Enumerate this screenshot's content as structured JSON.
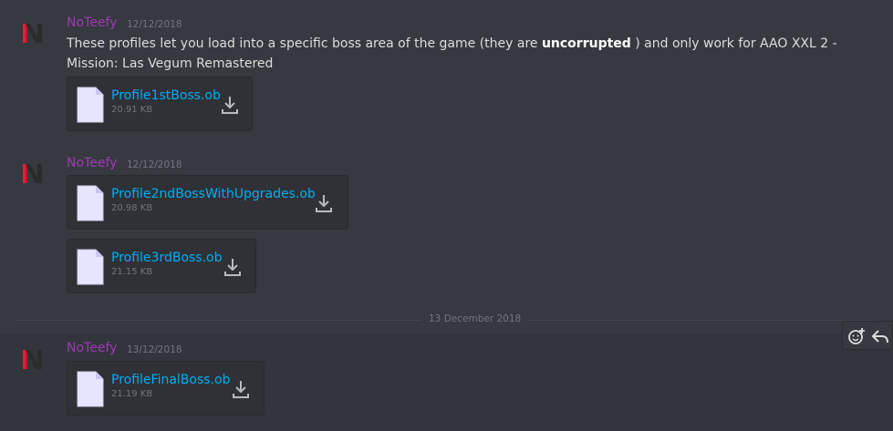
{
  "messages": [
    {
      "author": "NoTeefy",
      "timestamp": "12/12/2018",
      "text_before": "These profiles let you load into a specific boss area of the game (they are ",
      "text_bold": "uncorrupted",
      "text_after": " ) and only work for AAO XXL 2 - Mission: Las Vegum Remastered",
      "attachments": [
        {
          "name": "Profile1stBoss.ob",
          "size": "20.91 KB"
        }
      ]
    },
    {
      "author": "NoTeefy",
      "timestamp": "12/12/2018",
      "attachments": [
        {
          "name": "Profile2ndBossWithUpgrades.ob",
          "size": "20.98 KB"
        },
        {
          "name": "Profile3rdBoss.ob",
          "size": "21.15 KB"
        }
      ]
    },
    {
      "author": "NoTeefy",
      "timestamp": "13/12/2018",
      "attachments": [
        {
          "name": "ProfileFinalBoss.ob",
          "size": "21.19 KB"
        }
      ]
    }
  ],
  "date_divider": "13 December 2018",
  "icons": {
    "avatar": "noteefy-avatar-icon",
    "file": "file-icon",
    "download": "download-icon",
    "add_reaction": "add-reaction-icon",
    "reply": "reply-icon"
  },
  "colors": {
    "background": "#36393f",
    "username": "#a03ab8",
    "link": "#00b0f4",
    "text": "#dcddde",
    "muted": "#72767d"
  }
}
